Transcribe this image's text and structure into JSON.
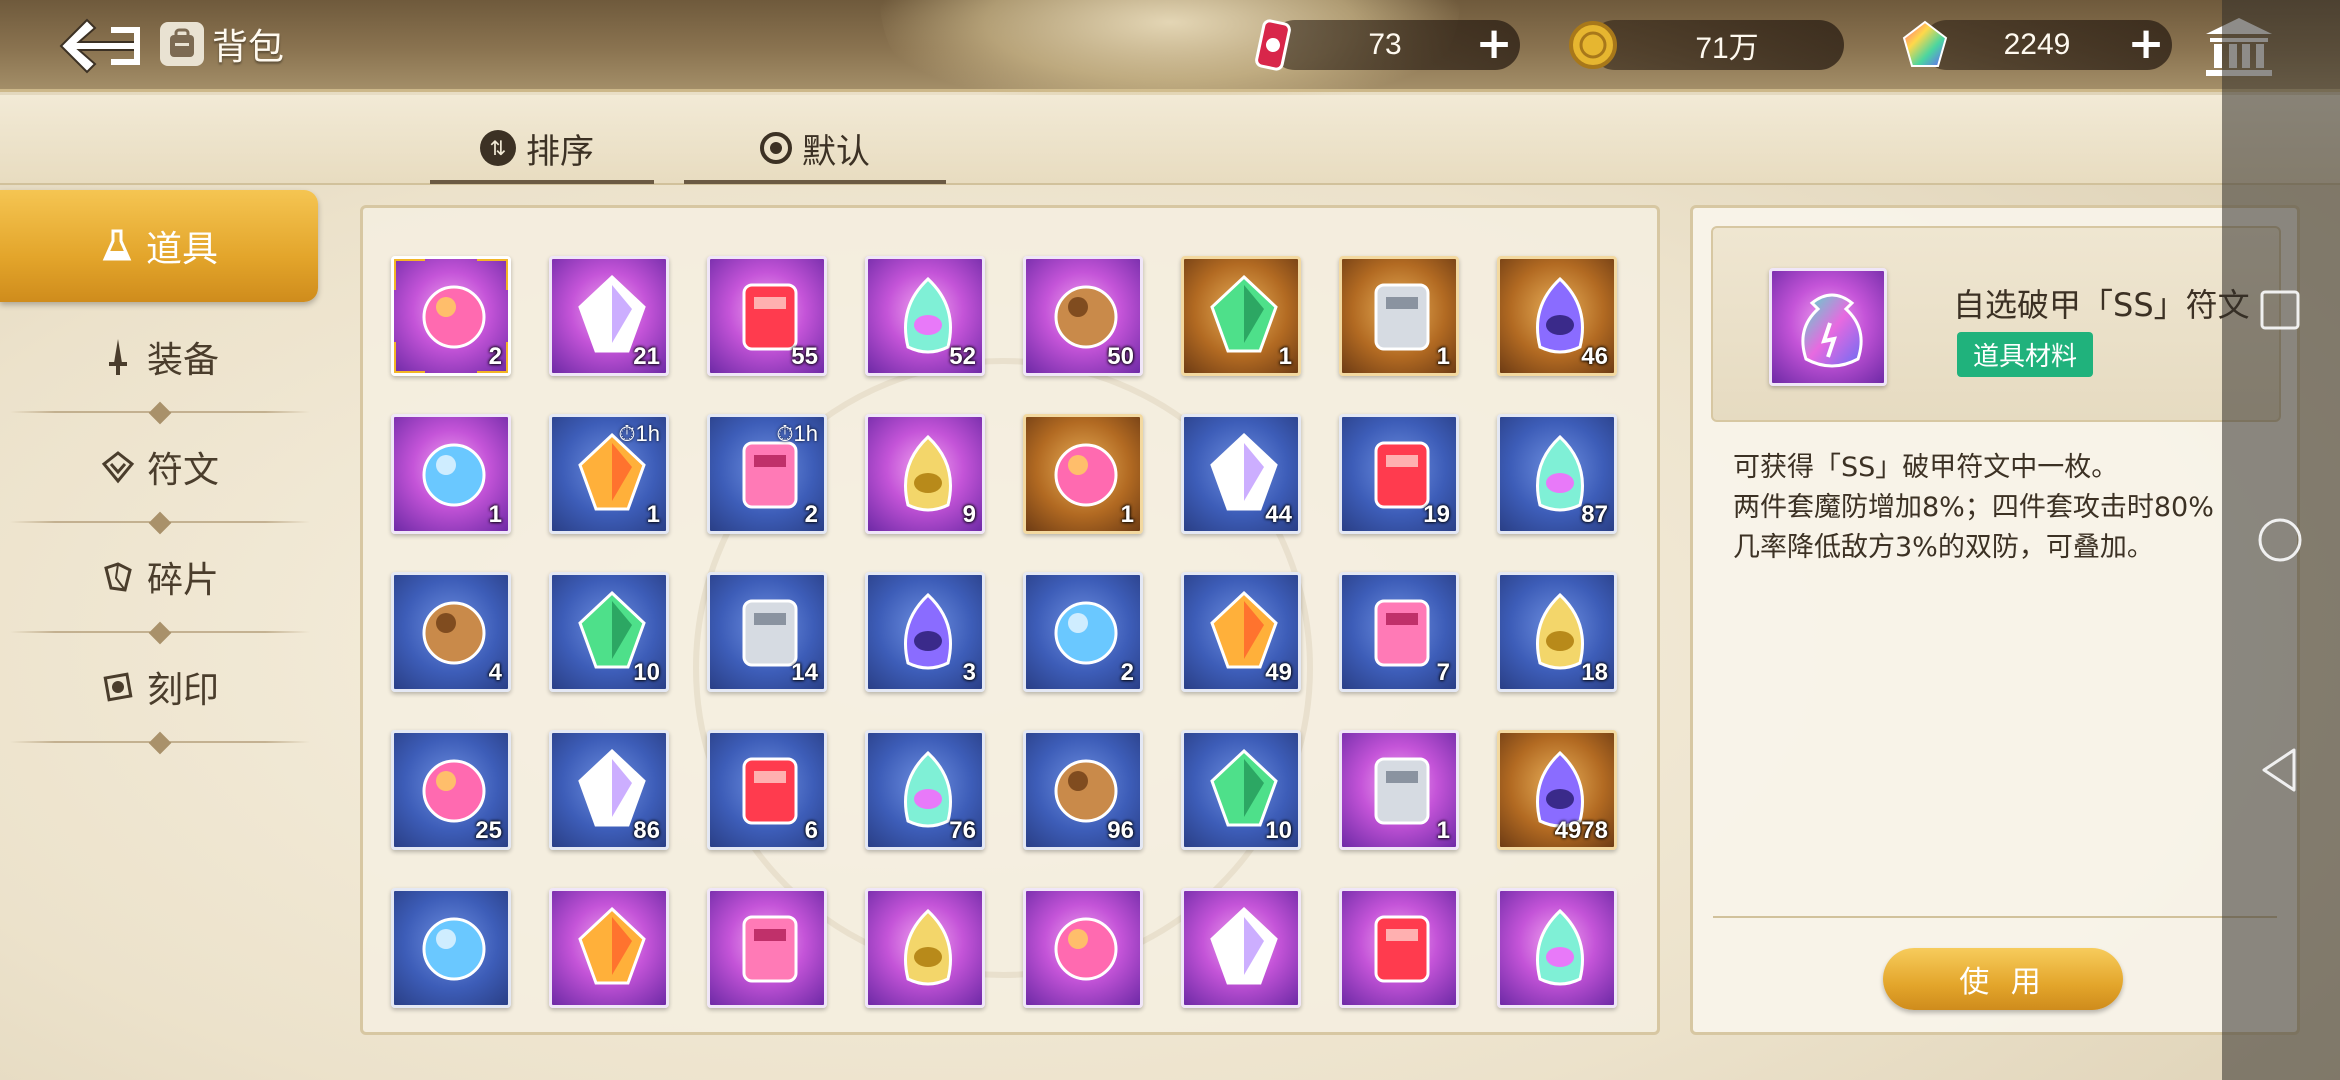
{
  "header": {
    "title": "背包",
    "currencies": [
      {
        "icon": "energy-can-icon",
        "value": "73"
      },
      {
        "icon": "gold-coin-icon",
        "value": "71万"
      },
      {
        "icon": "rainbow-gem-icon",
        "value": "2249"
      }
    ]
  },
  "sort": {
    "sort_label": "排序",
    "default_label": "默认"
  },
  "categories": [
    {
      "label": "道具",
      "icon": "flask-icon",
      "active": true
    },
    {
      "label": "装备",
      "icon": "sword-icon",
      "active": false
    },
    {
      "label": "符文",
      "icon": "rune-icon",
      "active": false
    },
    {
      "label": "碎片",
      "icon": "shard-icon",
      "active": false
    },
    {
      "label": "刻印",
      "icon": "seal-icon",
      "active": false
    }
  ],
  "items": [
    {
      "icon": "rainbow-pouch-icon",
      "qty": "2",
      "rarity": "purple"
    },
    {
      "icon": "mystery-card-purple-icon",
      "qty": "21",
      "rarity": "purple"
    },
    {
      "icon": "character-card-purple-icon",
      "qty": "55",
      "rarity": "purple"
    },
    {
      "icon": "red-potion-flask-icon",
      "qty": "52",
      "rarity": "purple"
    },
    {
      "icon": "prism-crystal-icon",
      "qty": "50",
      "rarity": "purple"
    },
    {
      "icon": "wooden-crate-icon",
      "qty": "1",
      "rarity": "gold"
    },
    {
      "icon": "mystery-card-gold-icon",
      "qty": "1",
      "rarity": "gold"
    },
    {
      "icon": "character-card-gold-icon",
      "qty": "46",
      "rarity": "gold"
    },
    {
      "icon": "soda-cans-icon",
      "qty": "1",
      "rarity": "purple"
    },
    {
      "icon": "hourglass-coins-icon",
      "qty": "1",
      "rarity": "blue",
      "timer": "1h"
    },
    {
      "icon": "hourglass-crystals-icon",
      "qty": "2",
      "rarity": "blue",
      "timer": "1h"
    },
    {
      "icon": "rose-bouquet-icon",
      "qty": "9",
      "rarity": "purple"
    },
    {
      "icon": "gift-box-icon",
      "qty": "1",
      "rarity": "gold"
    },
    {
      "icon": "green-ore-icon",
      "qty": "44",
      "rarity": "blue"
    },
    {
      "icon": "silver-ore-icon",
      "qty": "19",
      "rarity": "blue"
    },
    {
      "icon": "leaf-icon",
      "qty": "87",
      "rarity": "blue"
    },
    {
      "icon": "violet-ore-icon",
      "qty": "4",
      "rarity": "blue"
    },
    {
      "icon": "water-bowl-icon",
      "qty": "10",
      "rarity": "blue"
    },
    {
      "icon": "orange-potion-icon",
      "qty": "14",
      "rarity": "blue"
    },
    {
      "icon": "pink-potion-icon",
      "qty": "3",
      "rarity": "blue"
    },
    {
      "icon": "red-jar-icon",
      "qty": "2",
      "rarity": "blue"
    },
    {
      "icon": "grain-pile-icon",
      "qty": "49",
      "rarity": "blue"
    },
    {
      "icon": "feather-icon",
      "qty": "7",
      "rarity": "blue"
    },
    {
      "icon": "golden-apple-icon",
      "qty": "18",
      "rarity": "blue"
    },
    {
      "icon": "umbrella-icon",
      "qty": "25",
      "rarity": "blue"
    },
    {
      "icon": "lighter-icon",
      "qty": "86",
      "rarity": "blue"
    },
    {
      "icon": "open-book-icon",
      "qty": "6",
      "rarity": "blue"
    },
    {
      "icon": "tome-icon",
      "qty": "76",
      "rarity": "blue"
    },
    {
      "icon": "medal-icon",
      "qty": "96",
      "rarity": "blue"
    },
    {
      "icon": "pink-pillow-icon",
      "qty": "10",
      "rarity": "blue"
    },
    {
      "icon": "blue-crystal-icon",
      "qty": "1",
      "rarity": "purple"
    },
    {
      "icon": "sapphire-icon",
      "qty": "4978",
      "rarity": "gold"
    },
    {
      "icon": "clear-crystal-icon",
      "qty": "",
      "rarity": "blue"
    },
    {
      "icon": "dagger-icon",
      "qty": "",
      "rarity": "purple"
    },
    {
      "icon": "red-gem-icon",
      "qty": "",
      "rarity": "purple"
    },
    {
      "icon": "cube-icon",
      "qty": "",
      "rarity": "purple"
    },
    {
      "icon": "ice-crystal-icon",
      "qty": "",
      "rarity": "purple"
    },
    {
      "icon": "blue-ticket-icon",
      "qty": "",
      "rarity": "purple"
    },
    {
      "icon": "orb-icon",
      "qty": "",
      "rarity": "purple"
    },
    {
      "icon": "rainbow-amulet-icon",
      "qty": "",
      "rarity": "purple"
    }
  ],
  "detail": {
    "name": "自选破甲「SS」符文",
    "tag": "道具材料",
    "desc_1": "可获得「SS」破甲符文中一枚。",
    "desc_2": "两件套魔防增加8%；四件套攻击时80%",
    "desc_3": "几率降低敌方3%的双防，可叠加。",
    "use_label": "使 用"
  },
  "colors": {
    "accent_gold": "#e3a52b",
    "tag_green": "#20b27c",
    "rarity_purple": "#c454d8",
    "rarity_blue": "#3d5db8",
    "rarity_gold": "#b26a22"
  }
}
